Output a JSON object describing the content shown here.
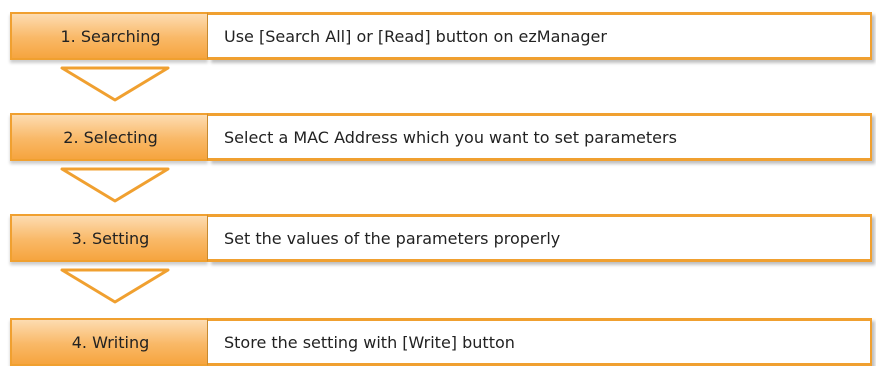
{
  "colors": {
    "accent": "#f6a53f",
    "border": "#f0a030",
    "arrow_fill": "#ffffff"
  },
  "steps": [
    {
      "label": "1. Searching",
      "desc": "Use [Search All] or [Read] button on ezManager"
    },
    {
      "label": "2. Selecting",
      "desc": "Select a MAC Address which you want to set parameters"
    },
    {
      "label": "3. Setting",
      "desc": "Set the values of the parameters properly"
    },
    {
      "label": "4. Writing",
      "desc": "Store the setting with [Write] button"
    }
  ],
  "arrows": [
    {
      "icon": "chevron-down-arrow-icon"
    },
    {
      "icon": "chevron-down-arrow-icon"
    },
    {
      "icon": "chevron-down-arrow-icon"
    }
  ]
}
